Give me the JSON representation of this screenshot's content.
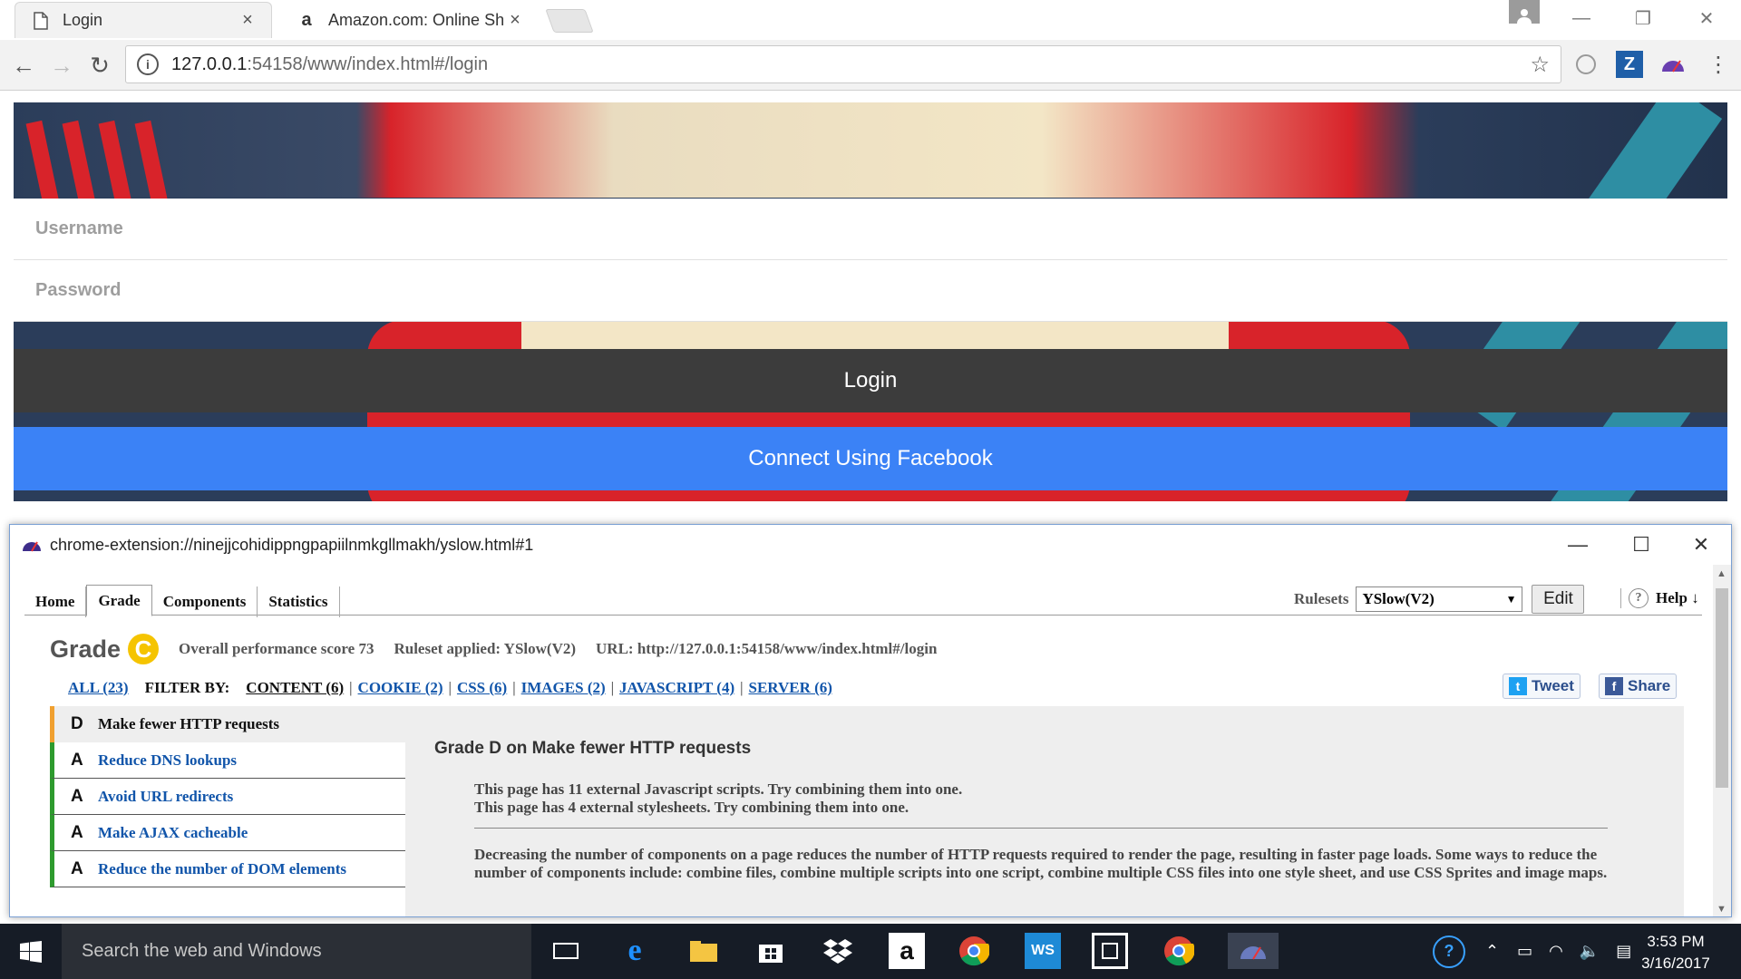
{
  "browser": {
    "tabs": [
      {
        "label": "Login",
        "close": "×"
      },
      {
        "label": "Amazon.com: Online Sho",
        "close": "×"
      }
    ],
    "url_host": "127.0.0.1",
    "url_path": ":54158/www/index.html#/login",
    "info_glyph": "i",
    "star_glyph": "☆"
  },
  "page": {
    "username_placeholder": "Username",
    "password_placeholder": "Password",
    "login_label": "Login",
    "facebook_label": "Connect Using Facebook",
    "colors": {
      "login_bg": "#3c3c3c",
      "facebook_bg": "#3b82f6"
    }
  },
  "popup": {
    "title": "chrome-extension://ninejjcohidippngpapiilnmkgllmakh/yslow.html#1",
    "tabs": [
      "Home",
      "Grade",
      "Components",
      "Statistics"
    ],
    "active_tab": "Grade",
    "rulesets_label": "Rulesets",
    "ruleset_value": "YSlow(V2)",
    "edit_label": "Edit",
    "help_label": "Help ↓",
    "grade_title": "Grade",
    "grade_letter": "C",
    "score_text": "Overall performance score 73",
    "ruleset_applied": "Ruleset applied: YSlow(V2)",
    "url_text": "URL: http://127.0.0.1:54158/www/index.html#/login",
    "filters": {
      "all": "ALL (23)",
      "filter_by": "FILTER BY:",
      "content": "CONTENT (6)",
      "cookie": "COOKIE (2)",
      "css": "CSS (6)",
      "images": "IMAGES (2)",
      "javascript": "JAVASCRIPT (4)",
      "server": "SERVER (6)"
    },
    "tweet_label": "Tweet",
    "share_label": "Share",
    "rules": [
      {
        "grade": "D",
        "title": "Make fewer HTTP requests"
      },
      {
        "grade": "A",
        "title": "Reduce DNS lookups"
      },
      {
        "grade": "A",
        "title": "Avoid URL redirects"
      },
      {
        "grade": "A",
        "title": "Make AJAX cacheable"
      },
      {
        "grade": "A",
        "title": "Reduce the number of DOM elements"
      }
    ],
    "detail": {
      "heading": "Grade D on Make fewer HTTP requests",
      "msg1": "This page has 11 external Javascript scripts. Try combining them into one.",
      "msg2": "This page has 4 external stylesheets. Try combining them into one.",
      "desc": "Decreasing the number of components on a page reduces the number of HTTP requests required to render the page, resulting in faster page loads. Some ways to reduce the number of components include: combine files, combine multiple scripts into one script, combine multiple CSS files into one style sheet, and use CSS Sprites and image maps."
    },
    "colors": {
      "grade_c": "#f5c400",
      "rule_a": "#2e9b2e",
      "rule_d": "#f0a030",
      "link": "#1155aa"
    }
  },
  "taskbar": {
    "search_placeholder": "Search the web and Windows",
    "time": "3:53 PM",
    "date": "3/16/2017"
  }
}
